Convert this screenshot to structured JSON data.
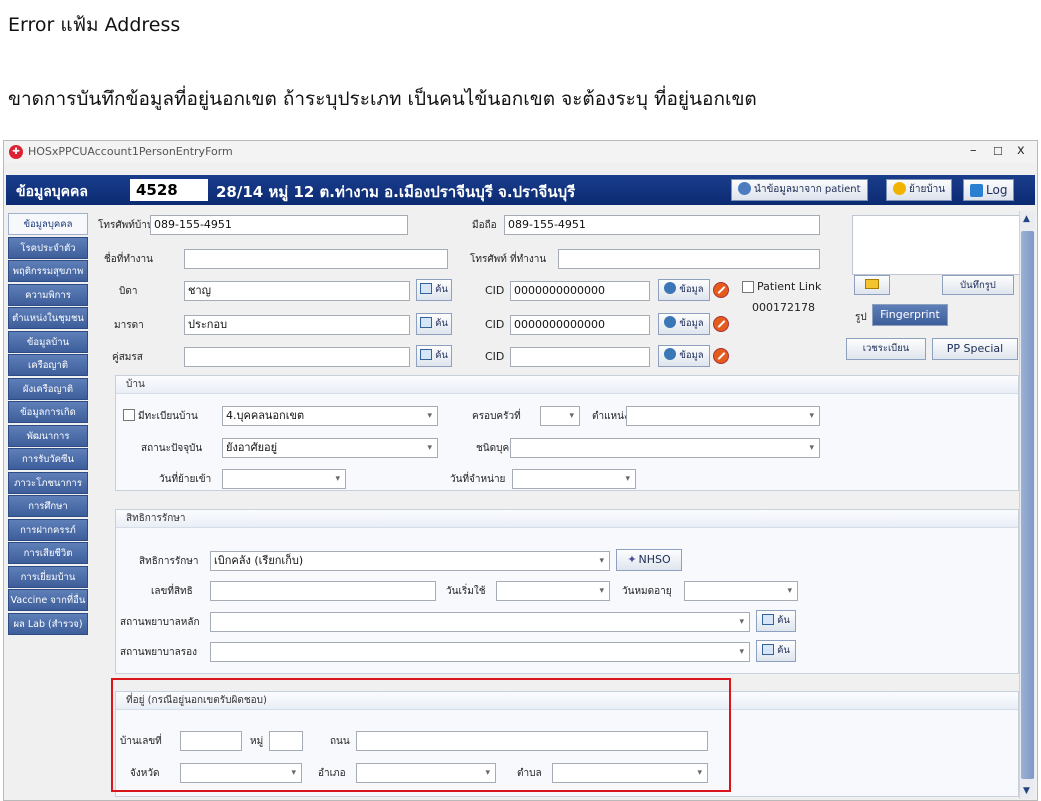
{
  "document": {
    "title": "Error แฟ้ม Address",
    "description": "ขาดการบันทึกข้อมูลที่อยู่นอกเขต ถ้าระบุประเภท เป็นคนไข้นอกเขต จะต้องระบุ ที่อยู่นอกเขต"
  },
  "window": {
    "title": "HOSxPPCUAccount1PersonEntryForm",
    "minimize": "–",
    "maximize": "☐",
    "close": "x"
  },
  "header": {
    "label": "ข้อมูลบุคคล",
    "hn": "4528",
    "address": "28/14 หมู่ 12 ต.ท่างาม อ.เมืองปราจีนบุรี จ.ปราจีนบุรี",
    "import_button": "นำข้อมูลมาจาก patient",
    "move_button": "ย้ายบ้าน",
    "log_button": "Log"
  },
  "nav": [
    "ข้อมูลบุคคล",
    "โรคประจำตัว",
    "พฤติกรรมสุขภาพ",
    "ความพิการ",
    "ตำแหน่งในชุมชน",
    "ข้อมูลบ้าน",
    "เครือญาติ",
    "ผังเครือญาติ",
    "ข้อมูลการเกิด",
    "พัฒนาการ",
    "การรับวัคซีน",
    "ภาวะโภชนาการ",
    "การศึกษา",
    "การฝากครรภ์",
    "การเสียชีวิต",
    "การเยี่ยมบ้าน",
    "Vaccine จากที่อื่น",
    "ผล Lab (สำรวจ)"
  ],
  "personal": {
    "home_phone_label": "โทรศัพท์บ้าน",
    "home_phone": "089-155-4951",
    "mobile_label": "มือถือ",
    "mobile": "089-155-4951",
    "workplace_label": "ชื่อที่ทำงาน",
    "workplace": "",
    "work_phone_label": "โทรศัพท์ ที่ทำงาน",
    "work_phone": "",
    "father_label": "บิดา",
    "father": "ชาญ",
    "mother_label": "มารดา",
    "mother": "ประกอบ",
    "spouse_label": "คู่สมรส",
    "spouse": "",
    "find_label": "ค้น",
    "cid_label": "CID",
    "father_cid": "0000000000000",
    "mother_cid": "0000000000000",
    "spouse_cid": "",
    "info_label": "ข้อมูล",
    "patient_link_label": "Patient Link",
    "patient_link_id": "000172178",
    "save_photo_label": "บันทึกรูป",
    "photo_label": "รูป",
    "fingerprint_label": "Fingerprint",
    "registry_label": "เวชระเบียน",
    "pp_special_label": "PP Special"
  },
  "house": {
    "title": "บ้าน",
    "registered_label": "มีทะเบียนบ้าน",
    "type": "4.บุคคลนอกเขต",
    "family_label": "ครอบครัวที่",
    "family": "",
    "position_label": "ตำแหน่ง",
    "position": "",
    "status_label": "สถานะปัจจุบัน",
    "status": "ยังอาศัยอยู่",
    "person_type_label": "ชนิดบุคคล",
    "person_type": "",
    "move_in_label": "วันที่ย้ายเข้า",
    "move_in": "",
    "discharge_label": "วันที่จำหน่าย",
    "discharge": ""
  },
  "rights": {
    "title": "สิทธิการรักษา",
    "right_label": "สิทธิการรักษา",
    "right": "เบิกคลัง (เรียกเก็บ)",
    "nhso_label": "NHSO",
    "number_label": "เลขที่สิทธิ",
    "number": "",
    "start_label": "วันเริ่มใช้",
    "start": "",
    "expire_label": "วันหมดอายุ",
    "expire": "",
    "main_hosp_label": "สถานพยาบาลหลัก",
    "main_hosp": "",
    "sub_hosp_label": "สถานพยาบาลรอง",
    "sub_hosp": "",
    "find_label": "ค้น"
  },
  "address": {
    "title": "ที่อยู่ (กรณีอยู่นอกเขตรับผิดชอบ)",
    "house_no_label": "บ้านเลขที่",
    "house_no": "",
    "moo_label": "หมู่",
    "moo": "",
    "road_label": "ถนน",
    "road": "",
    "province_label": "จังหวัด",
    "province": "",
    "district_label": "อำเภอ",
    "district": "",
    "subdistrict_label": "ตำบล",
    "subdistrict": ""
  },
  "colors": {
    "header_bg": "#0b2a72",
    "nav_bg": "#3d5e9a",
    "highlight": "#d9161c"
  }
}
